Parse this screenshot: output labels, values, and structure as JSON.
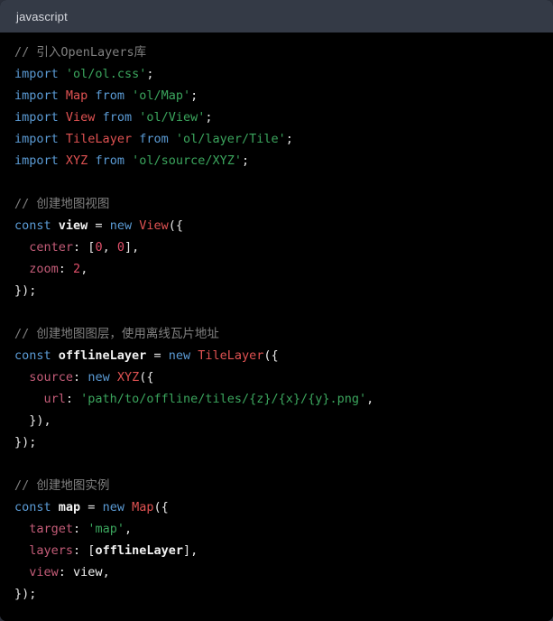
{
  "header": {
    "language_label": "javascript"
  },
  "colors": {
    "header_bg": "#343a46",
    "code_bg": "#000000",
    "page_bg": "#2b2f3a",
    "comment": "#808080",
    "keyword": "#5b9bd5",
    "class_name": "#e05252",
    "string": "#3ba55d",
    "property_key": "#c45c78",
    "number": "#e0506a",
    "plain_text": "#e6e6e6",
    "label_text": "#d8dae0"
  },
  "code": {
    "language": "javascript",
    "lines": [
      {
        "indent": 0,
        "tokens": [
          {
            "t": "comment",
            "v": "// 引入OpenLayers库"
          }
        ]
      },
      {
        "indent": 0,
        "tokens": [
          {
            "t": "keyword",
            "v": "import"
          },
          {
            "t": "plain",
            "v": " "
          },
          {
            "t": "string",
            "v": "'ol/ol.css'"
          },
          {
            "t": "plain",
            "v": ";"
          }
        ]
      },
      {
        "indent": 0,
        "tokens": [
          {
            "t": "keyword",
            "v": "import"
          },
          {
            "t": "plain",
            "v": " "
          },
          {
            "t": "class",
            "v": "Map"
          },
          {
            "t": "plain",
            "v": " "
          },
          {
            "t": "keyword",
            "v": "from"
          },
          {
            "t": "plain",
            "v": " "
          },
          {
            "t": "string",
            "v": "'ol/Map'"
          },
          {
            "t": "plain",
            "v": ";"
          }
        ]
      },
      {
        "indent": 0,
        "tokens": [
          {
            "t": "keyword",
            "v": "import"
          },
          {
            "t": "plain",
            "v": " "
          },
          {
            "t": "class",
            "v": "View"
          },
          {
            "t": "plain",
            "v": " "
          },
          {
            "t": "keyword",
            "v": "from"
          },
          {
            "t": "plain",
            "v": " "
          },
          {
            "t": "string",
            "v": "'ol/View'"
          },
          {
            "t": "plain",
            "v": ";"
          }
        ]
      },
      {
        "indent": 0,
        "tokens": [
          {
            "t": "keyword",
            "v": "import"
          },
          {
            "t": "plain",
            "v": " "
          },
          {
            "t": "class",
            "v": "TileLayer"
          },
          {
            "t": "plain",
            "v": " "
          },
          {
            "t": "keyword",
            "v": "from"
          },
          {
            "t": "plain",
            "v": " "
          },
          {
            "t": "string",
            "v": "'ol/layer/Tile'"
          },
          {
            "t": "plain",
            "v": ";"
          }
        ]
      },
      {
        "indent": 0,
        "tokens": [
          {
            "t": "keyword",
            "v": "import"
          },
          {
            "t": "plain",
            "v": " "
          },
          {
            "t": "class",
            "v": "XYZ"
          },
          {
            "t": "plain",
            "v": " "
          },
          {
            "t": "keyword",
            "v": "from"
          },
          {
            "t": "plain",
            "v": " "
          },
          {
            "t": "string",
            "v": "'ol/source/XYZ'"
          },
          {
            "t": "plain",
            "v": ";"
          }
        ]
      },
      {
        "indent": 0,
        "tokens": []
      },
      {
        "indent": 0,
        "tokens": [
          {
            "t": "comment",
            "v": "// 创建地图视图"
          }
        ]
      },
      {
        "indent": 0,
        "tokens": [
          {
            "t": "keyword",
            "v": "const"
          },
          {
            "t": "plain",
            "v": " "
          },
          {
            "t": "var",
            "v": "view"
          },
          {
            "t": "plain",
            "v": " = "
          },
          {
            "t": "keyword",
            "v": "new"
          },
          {
            "t": "plain",
            "v": " "
          },
          {
            "t": "class",
            "v": "View"
          },
          {
            "t": "plain",
            "v": "({"
          }
        ]
      },
      {
        "indent": 1,
        "tokens": [
          {
            "t": "key",
            "v": "center"
          },
          {
            "t": "plain",
            "v": ": ["
          },
          {
            "t": "num",
            "v": "0"
          },
          {
            "t": "plain",
            "v": ", "
          },
          {
            "t": "num",
            "v": "0"
          },
          {
            "t": "plain",
            "v": "],"
          }
        ]
      },
      {
        "indent": 1,
        "tokens": [
          {
            "t": "key",
            "v": "zoom"
          },
          {
            "t": "plain",
            "v": ": "
          },
          {
            "t": "num",
            "v": "2"
          },
          {
            "t": "plain",
            "v": ","
          }
        ]
      },
      {
        "indent": 0,
        "tokens": [
          {
            "t": "plain",
            "v": "});"
          }
        ]
      },
      {
        "indent": 0,
        "tokens": []
      },
      {
        "indent": 0,
        "tokens": [
          {
            "t": "comment",
            "v": "// 创建地图图层，使用离线瓦片地址"
          }
        ]
      },
      {
        "indent": 0,
        "tokens": [
          {
            "t": "keyword",
            "v": "const"
          },
          {
            "t": "plain",
            "v": " "
          },
          {
            "t": "var",
            "v": "offlineLayer"
          },
          {
            "t": "plain",
            "v": " = "
          },
          {
            "t": "keyword",
            "v": "new"
          },
          {
            "t": "plain",
            "v": " "
          },
          {
            "t": "class",
            "v": "TileLayer"
          },
          {
            "t": "plain",
            "v": "({"
          }
        ]
      },
      {
        "indent": 1,
        "tokens": [
          {
            "t": "key",
            "v": "source"
          },
          {
            "t": "plain",
            "v": ": "
          },
          {
            "t": "keyword",
            "v": "new"
          },
          {
            "t": "plain",
            "v": " "
          },
          {
            "t": "class",
            "v": "XYZ"
          },
          {
            "t": "plain",
            "v": "({"
          }
        ]
      },
      {
        "indent": 2,
        "tokens": [
          {
            "t": "key",
            "v": "url"
          },
          {
            "t": "plain",
            "v": ": "
          },
          {
            "t": "string",
            "v": "'path/to/offline/tiles/{z}/{x}/{y}.png'"
          },
          {
            "t": "plain",
            "v": ","
          }
        ]
      },
      {
        "indent": 1,
        "tokens": [
          {
            "t": "plain",
            "v": "}),"
          }
        ]
      },
      {
        "indent": 0,
        "tokens": [
          {
            "t": "plain",
            "v": "});"
          }
        ]
      },
      {
        "indent": 0,
        "tokens": []
      },
      {
        "indent": 0,
        "tokens": [
          {
            "t": "comment",
            "v": "// 创建地图实例"
          }
        ]
      },
      {
        "indent": 0,
        "tokens": [
          {
            "t": "keyword",
            "v": "const"
          },
          {
            "t": "plain",
            "v": " "
          },
          {
            "t": "var",
            "v": "map"
          },
          {
            "t": "plain",
            "v": " = "
          },
          {
            "t": "keyword",
            "v": "new"
          },
          {
            "t": "plain",
            "v": " "
          },
          {
            "t": "class",
            "v": "Map"
          },
          {
            "t": "plain",
            "v": "({"
          }
        ]
      },
      {
        "indent": 1,
        "tokens": [
          {
            "t": "key",
            "v": "target"
          },
          {
            "t": "plain",
            "v": ": "
          },
          {
            "t": "string",
            "v": "'map'"
          },
          {
            "t": "plain",
            "v": ","
          }
        ]
      },
      {
        "indent": 1,
        "tokens": [
          {
            "t": "key",
            "v": "layers"
          },
          {
            "t": "plain",
            "v": ": ["
          },
          {
            "t": "var",
            "v": "offlineLayer"
          },
          {
            "t": "plain",
            "v": "],"
          }
        ]
      },
      {
        "indent": 1,
        "tokens": [
          {
            "t": "key",
            "v": "view"
          },
          {
            "t": "plain",
            "v": ": "
          },
          {
            "t": "ident",
            "v": "view"
          },
          {
            "t": "plain",
            "v": ","
          }
        ]
      },
      {
        "indent": 0,
        "tokens": [
          {
            "t": "plain",
            "v": "});"
          }
        ]
      }
    ]
  }
}
